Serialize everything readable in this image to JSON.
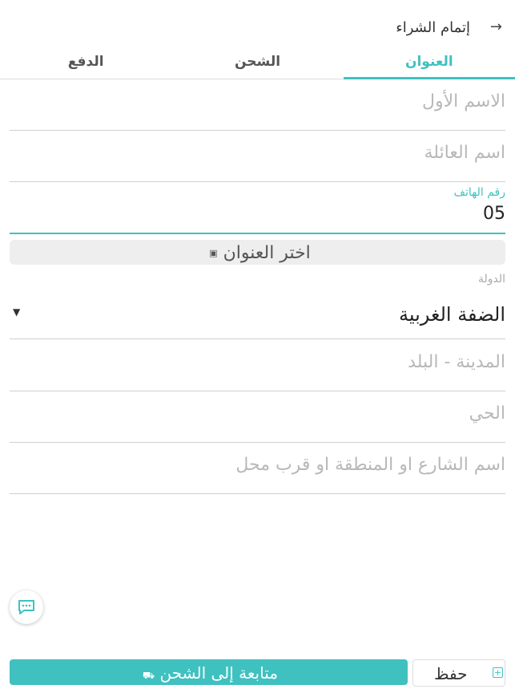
{
  "header": {
    "title": "إتمام الشراء",
    "back_icon": "arrow-right-icon"
  },
  "tabs": [
    {
      "label": "العنوان",
      "active": true
    },
    {
      "label": "الشحن",
      "active": false
    },
    {
      "label": "الدفع",
      "active": false
    }
  ],
  "form": {
    "first_name_placeholder": "الاسم الأول",
    "last_name_placeholder": "اسم العائلة",
    "phone_label": "رقم الهاتف",
    "phone_value": "05",
    "choose_address_label": "اختر العنوان",
    "country_label": "الدولة",
    "country_value": "الضفة الغربية",
    "city_placeholder": "المدينة - البلد",
    "district_placeholder": "الحي",
    "street_placeholder": "اسم الشارع او المنطقة او قرب محل"
  },
  "footer": {
    "continue_label": "متابعة إلى الشحن",
    "save_label": "حفظ"
  },
  "colors": {
    "accent": "#3fc1c0"
  }
}
